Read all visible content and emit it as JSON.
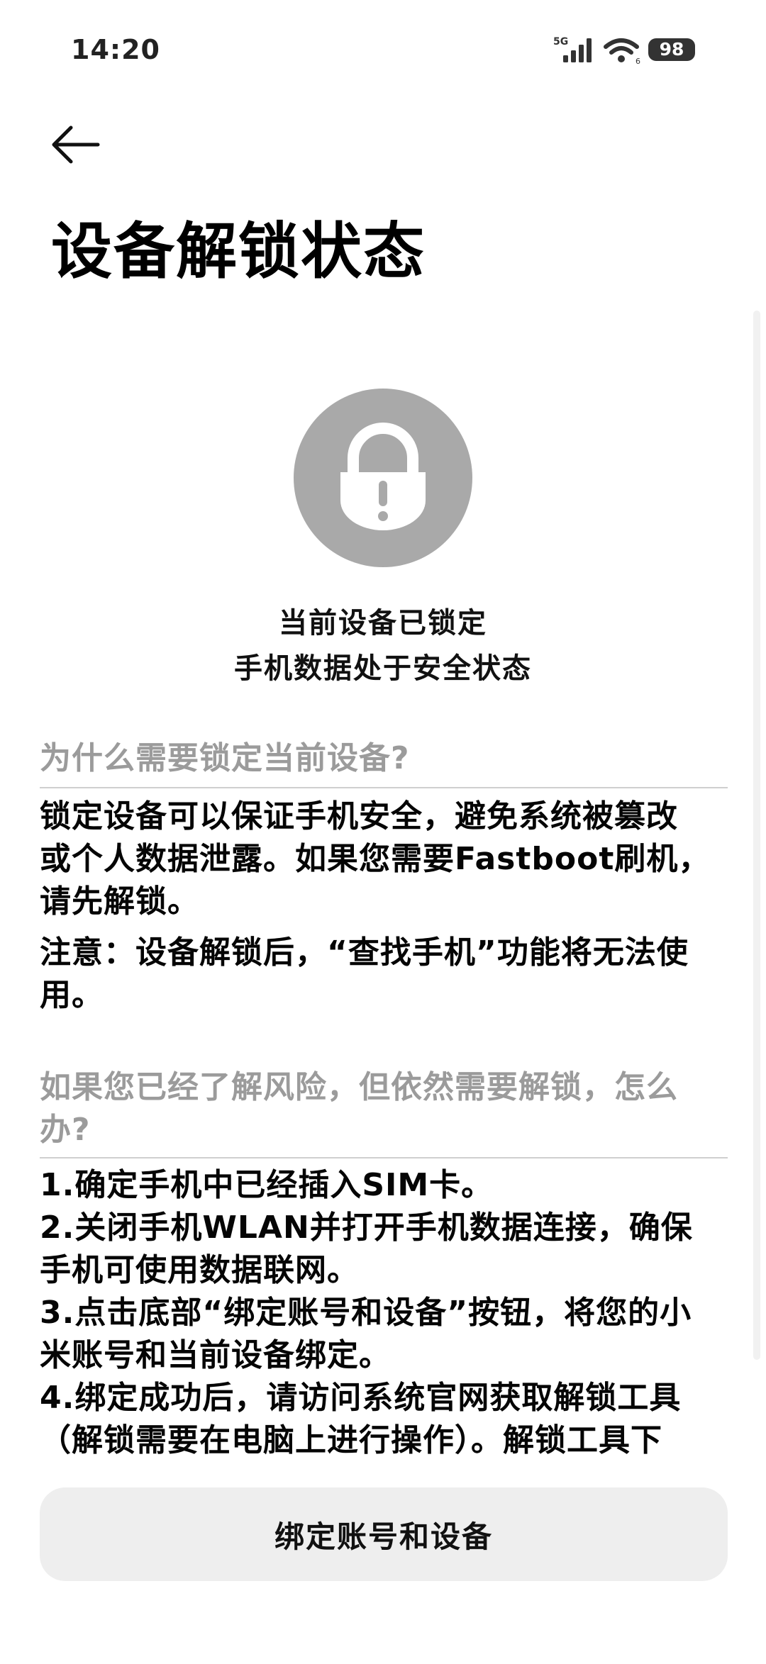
{
  "status_bar": {
    "time": "14:20",
    "network": "5G",
    "battery": "98"
  },
  "header": {
    "back_icon": "arrow-left-icon",
    "title": "设备解锁状态"
  },
  "lock_status": {
    "icon": "padlock-warning-icon",
    "line1": "当前设备已锁定",
    "line2": "手机数据处于安全状态"
  },
  "section_why": {
    "heading": "为什么需要锁定当前设备?",
    "paragraphs": [
      [
        "锁定设备可以保证手机安全，避免系统被篡改",
        "或个人数据泄露。如果您需要Fastboot刷机，",
        "请先解锁。"
      ],
      [
        "注意：设备解锁后，“查找手机”功能将无法使",
        "用。"
      ]
    ]
  },
  "section_how": {
    "heading_lines": [
      "如果您已经了解风险，但依然需要解锁，怎么",
      "办?"
    ],
    "lines": [
      "1.确定手机中已经插入SIM卡。",
      "2.关闭手机WLAN并打开手机数据连接，确保",
      "手机可使用数据联网。",
      "3.点击底部“绑定账号和设备”按钮，将您的小",
      "米账号和当前设备绑定。",
      "4.绑定成功后，请访问系统官网获取解锁工具",
      "（解锁需要在电脑上进行操作）。解锁工具下"
    ]
  },
  "bind_button": {
    "label": "绑定账号和设备"
  },
  "colors": {
    "lock_circle": "#a9a9a9",
    "heading_gray": "#9b9b9b",
    "button_bg": "#eeeeee"
  }
}
